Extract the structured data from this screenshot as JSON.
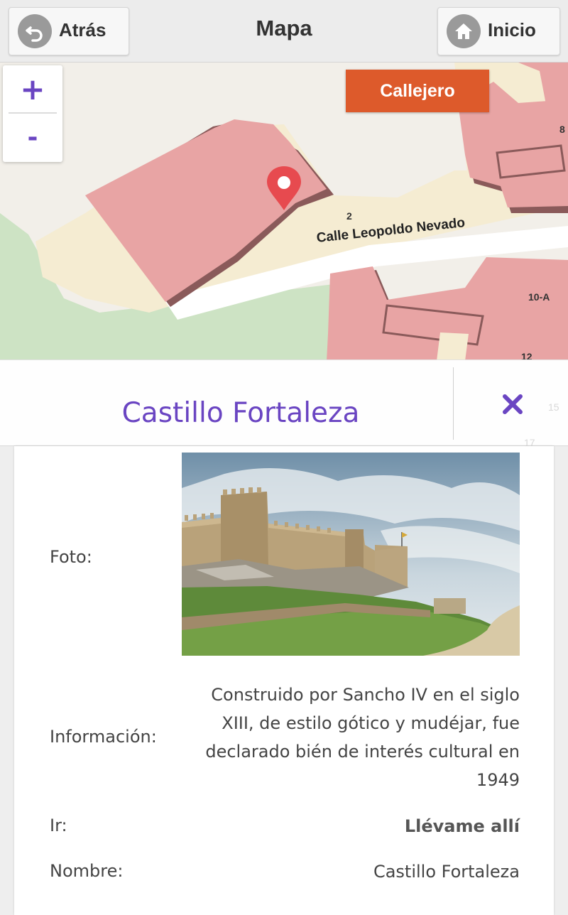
{
  "header": {
    "title": "Mapa",
    "back_label": "Atrás",
    "home_label": "Inicio",
    "back_icon": "back-arrow-icon",
    "home_icon": "home-icon"
  },
  "map": {
    "zoom_in": "+",
    "zoom_out": "-",
    "layer_button": "Callejero",
    "street_name": "Calle Leopoldo Nevado",
    "house_numbers": [
      "2",
      "8",
      "10-A",
      "12",
      "15",
      "17"
    ],
    "marker_icon": "map-pin-icon",
    "colors": {
      "building": "#e8a4a4",
      "land": "#f5ecd2",
      "park": "#cde3c4",
      "road": "#ffffff",
      "accent": "#dd5a2b",
      "marker": "#e74a4f"
    }
  },
  "place": {
    "name": "Castillo Fortaleza",
    "close_icon": "close-icon",
    "accent_color": "#6a45c2",
    "rows": {
      "photo_label": "Foto:",
      "info_label": "Información:",
      "info_lines": [
        "Construido por Sancho IV en el siglo",
        "XIII, de estilo gótico y mudéjar, fue",
        "declarado bién de interés cultural en",
        "1949"
      ],
      "go_label": "Ir:",
      "go_value": "Llévame allí",
      "name_label": "Nombre:",
      "name_value": "Castillo Fortaleza"
    }
  }
}
